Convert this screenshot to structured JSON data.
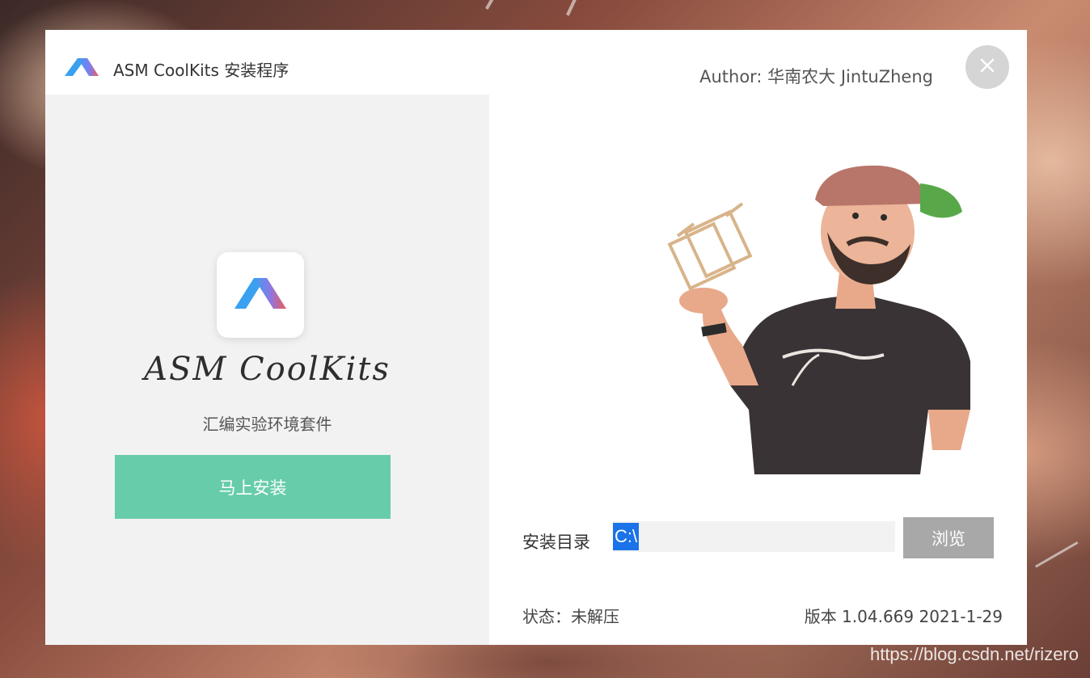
{
  "window": {
    "title": "ASM CoolKits 安装程序",
    "author": "Author: 华南农大 JintuZheng",
    "close_icon": "close-icon"
  },
  "left": {
    "app_name": "ASM CoolKits",
    "subtitle": "汇编实验环境套件",
    "install_button": "马上安装",
    "logo_icon": "app-logo-icon"
  },
  "right": {
    "dir_label": "安装目录",
    "dir_value": "C:\\",
    "browse_button": "浏览",
    "status": "状态：未解压",
    "version": "版本 1.04.669 2021-1-29",
    "illustration": "man-with-cube-illustration"
  },
  "watermark": "https://blog.csdn.net/rizero",
  "colors": {
    "accent_green": "#66ccaa",
    "browse_gray": "#a8a8a8",
    "selection_blue": "#1a73e8",
    "logo_blue": "#3aa0f0",
    "logo_red": "#f05a5a"
  }
}
